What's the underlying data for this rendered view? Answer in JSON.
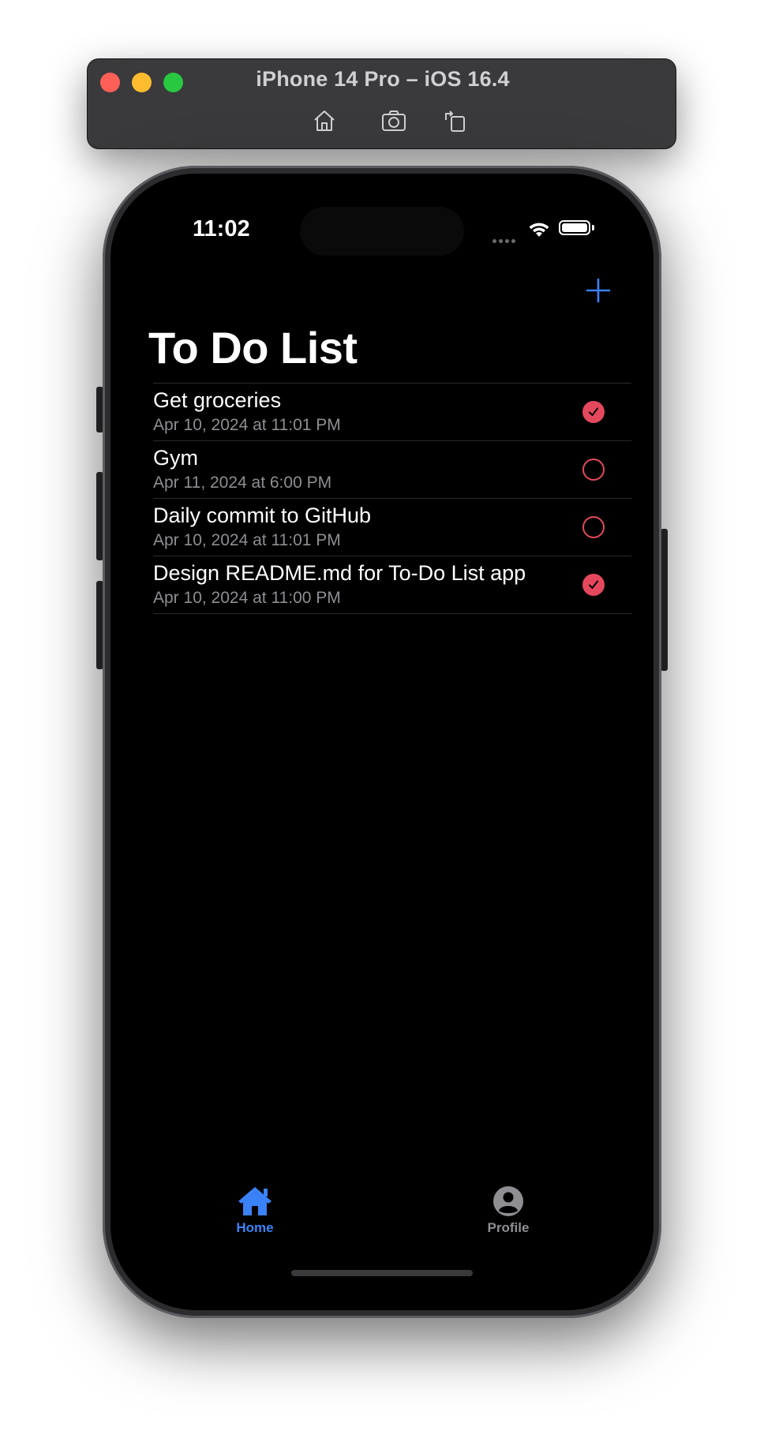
{
  "simulator": {
    "title": "iPhone 14 Pro – iOS 16.4",
    "tools": [
      {
        "icon": "home-icon"
      },
      {
        "icon": "screenshot-icon"
      },
      {
        "icon": "rotate-icon"
      }
    ]
  },
  "status_bar": {
    "time": "11:02",
    "wifi_icon": "wifi-icon",
    "battery_icon": "battery-icon"
  },
  "nav": {
    "title": "To Do List",
    "add_icon": "plus-icon"
  },
  "todos": [
    {
      "title": "Get groceries",
      "date": "Apr 10, 2024 at 11:01 PM",
      "done": true
    },
    {
      "title": "Gym",
      "date": "Apr 11, 2024 at 6:00 PM",
      "done": false
    },
    {
      "title": "Daily commit to GitHub",
      "date": "Apr 10, 2024 at 11:01 PM",
      "done": false
    },
    {
      "title": "Design README.md for To-Do List app",
      "date": "Apr 10, 2024 at 11:00 PM",
      "done": true
    }
  ],
  "tab_bar": {
    "tabs": [
      {
        "label": "Home",
        "icon": "house-icon",
        "selected": true
      },
      {
        "label": "Profile",
        "icon": "person-circle-icon",
        "selected": false
      }
    ]
  },
  "colors": {
    "accent": "#3a82f7",
    "check": "#e5485c",
    "background": "#000000",
    "secondary_text": "#8e8e93"
  }
}
